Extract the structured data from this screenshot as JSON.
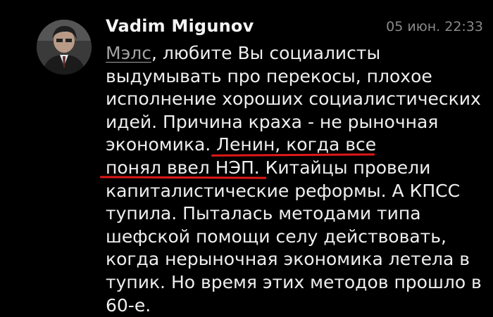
{
  "comment": {
    "author": "Vadim Migunov",
    "timestamp": "05 июн. 22:33",
    "mention": "Мэлс",
    "lines": [
      ", любите Вы социалисты",
      "выдумывать про перекосы, плохое",
      "исполнение хороших социалистических",
      "идей. Причина краха - не рыночная",
      "экономика. Ленин, когда все",
      "понял ввел НЭП. Китайцы провели",
      "капиталистические реформы. А КПСС",
      "тупила. Пыталась методами типа",
      "шефской помощи селу действовать,",
      "когда нерыночная экономика летела в",
      "тупик. Но время этих методов прошло в",
      "60-е."
    ]
  },
  "colors": {
    "background": "#000000",
    "text": "#efefef",
    "mention": "#a4a4a4",
    "timestamp": "#8a8a8a",
    "highlight_underline": "#e01818"
  },
  "icons": {
    "avatar": "user-photo"
  }
}
